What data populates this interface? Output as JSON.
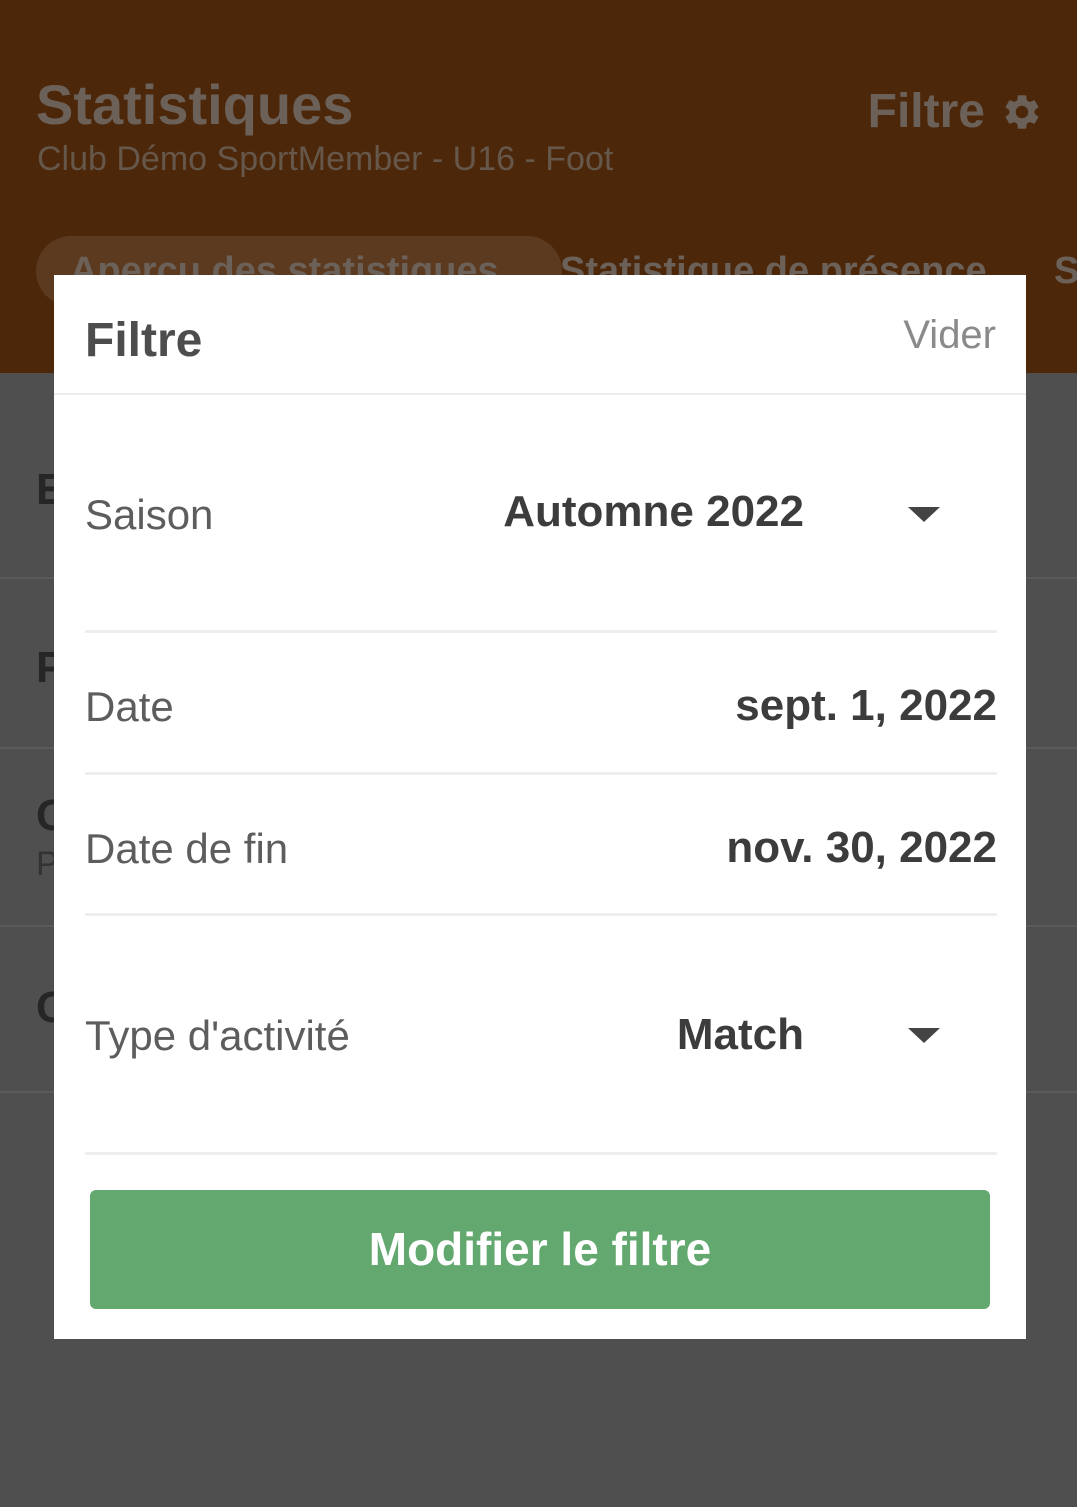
{
  "header": {
    "title": "Statistiques",
    "subtitle": "Club Démo SportMember - U16 - Foot",
    "filter_label": "Filtre",
    "filter_icon": "gear-icon"
  },
  "tabs": [
    {
      "label": "Aperçu des statistiques"
    },
    {
      "label": "Statistique de présence"
    },
    {
      "label": "S"
    }
  ],
  "background_rows": [
    {
      "letter": "E"
    },
    {
      "letter": "P"
    },
    {
      "letter": "C",
      "sub": "P"
    },
    {
      "letter": "C"
    }
  ],
  "modal": {
    "title": "Filtre",
    "clear_label": "Vider",
    "fields": {
      "season": {
        "label": "Saison",
        "value": "Automne 2022"
      },
      "date": {
        "label": "Date",
        "value": "sept. 1, 2022"
      },
      "end_date": {
        "label": "Date de fin",
        "value": "nov. 30, 2022"
      },
      "activity_type": {
        "label": "Type d'activité",
        "value": "Match"
      }
    },
    "submit_label": "Modifier le filtre"
  },
  "colors": {
    "header_bg": "#4d270a",
    "overlay_bg": "#4f4f4f",
    "primary_button": "#63a86f",
    "modal_bg": "#ffffff"
  }
}
